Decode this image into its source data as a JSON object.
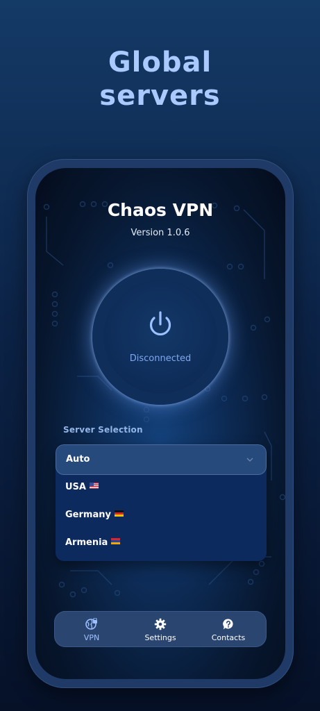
{
  "headline": {
    "line1": "Global",
    "line2": "servers"
  },
  "app": {
    "title": "Chaos VPN",
    "version": "Version 1.0.6"
  },
  "connection": {
    "status": "Disconnected"
  },
  "server_selection": {
    "label": "Server Selection",
    "selected": "Auto",
    "options": [
      {
        "label": "USA",
        "flag": "us-flag"
      },
      {
        "label": "Germany",
        "flag": "de-flag"
      },
      {
        "label": "Armenia",
        "flag": "am-flag"
      }
    ]
  },
  "nav": {
    "items": [
      {
        "label": "VPN",
        "icon": "globe-lock-icon",
        "active": true
      },
      {
        "label": "Settings",
        "icon": "gear-icon"
      },
      {
        "label": "Contacts",
        "icon": "help-chat-icon"
      }
    ]
  },
  "colors": {
    "accent": "#a9c9ff",
    "ring": "#6f9cf0",
    "status_text": "#7fa8ef",
    "nav_active": "#9fc1ff"
  }
}
